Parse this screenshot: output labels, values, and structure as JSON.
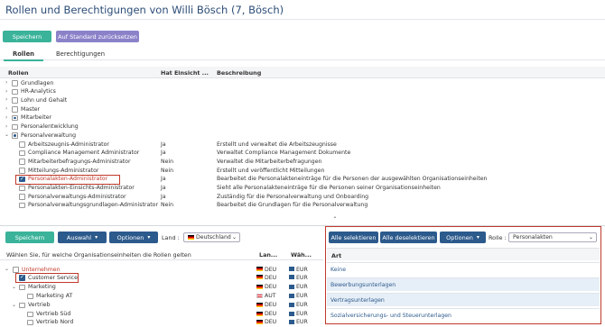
{
  "header": {
    "title": "Rollen und Berechtigungen von Willi Bösch (7, Bösch)"
  },
  "toolbar": {
    "save_label": "Speichern",
    "reset_label": "Auf Standard zurücksetzen"
  },
  "tabs": [
    {
      "label": "Rollen"
    },
    {
      "label": "Berechtigungen"
    }
  ],
  "roles_table": {
    "headers": {
      "roles": "Rollen",
      "has_view": "Hat Einsicht ...",
      "description": "Beschreibung"
    },
    "groups": [
      {
        "label": "Grundlagen"
      },
      {
        "label": "HR-Analytics"
      },
      {
        "label": "Lohn und Gehalt"
      },
      {
        "label": "Master"
      },
      {
        "label": "Mitarbeiter"
      },
      {
        "label": "Personalentwicklung"
      },
      {
        "label": "Personalverwaltung"
      }
    ],
    "rows": [
      {
        "name": "Arbeitszeugnis-Administrator",
        "view": "Ja",
        "desc": "Erstellt und verwaltet die Arbeitszeugnisse"
      },
      {
        "name": "Compliance Management Administrator",
        "view": "Ja",
        "desc": "Verwaltet Compliance Management Dokumente"
      },
      {
        "name": "Mitarbeiterbefragungs-Administrator",
        "view": "Nein",
        "desc": "Verwaltet die Mitarbeiterbefragungen"
      },
      {
        "name": "Mitteilungs-Administrator",
        "view": "Nein",
        "desc": "Erstellt und veröffentlicht Mitteilungen"
      },
      {
        "name": "Personalakten-Administrator",
        "view": "Ja",
        "desc": "Bearbeitet die Personalakteneinträge für die Personen der ausgewählten Organisationseinheiten"
      },
      {
        "name": "Personalakten-Einsichts-Administrator",
        "view": "Ja",
        "desc": "Sieht alle Personalakteneinträge für die Personen seiner Organisationseinheiten"
      },
      {
        "name": "Personalverwaltungs-Administrator",
        "view": "Ja",
        "desc": "Zuständig für die Personalverwaltung und Onboarding"
      },
      {
        "name": "Personalverwaltungsgrundlagen-Administrator",
        "view": "Nein",
        "desc": "Bearbeitet die Grundlagen für die Personalverwaltung"
      }
    ]
  },
  "bottom_toolbar": {
    "save_label": "Speichern",
    "selection_label": "Auswahl",
    "options_label": "Optionen",
    "land_label": "Land :",
    "land_value": "Deutschland"
  },
  "org_table": {
    "headers": {
      "prompt": "Wählen Sie, für welche Organisationseinheiten die Rollen gelten",
      "country": "Lan...",
      "currency": "Wäh..."
    },
    "rows": [
      {
        "name": "Unternehmen",
        "country": "DEU",
        "currency": "EUR"
      },
      {
        "name": "Customer Service",
        "country": "DEU",
        "currency": "EUR"
      },
      {
        "name": "Marketing",
        "country": "DEU",
        "currency": "EUR"
      },
      {
        "name": "Marketing AT",
        "country": "AUT",
        "currency": "EUR"
      },
      {
        "name": "Vertrieb",
        "country": "DEU",
        "currency": "EUR"
      },
      {
        "name": "Vertrieb Süd",
        "country": "DEU",
        "currency": "EUR"
      },
      {
        "name": "Vertrieb Nord",
        "country": "DEU",
        "currency": "EUR"
      }
    ]
  },
  "panel": {
    "select_all_label": "Alle selektieren",
    "deselect_all_label": "Alle deselektieren",
    "options_label": "Optionen",
    "role_label": "Rolle :",
    "role_value": "Personalakten",
    "column_header": "Art",
    "items": [
      {
        "label": "Keine"
      },
      {
        "label": "Bewerbungsunterlagen"
      },
      {
        "label": "Vertragsunterlagen"
      },
      {
        "label": "Sozialversicherungs- und Steuerunterlagen"
      }
    ]
  },
  "colors": {
    "accent": "#3ab39a",
    "primary": "#2c5a8c",
    "highlight": "#c0392b"
  }
}
